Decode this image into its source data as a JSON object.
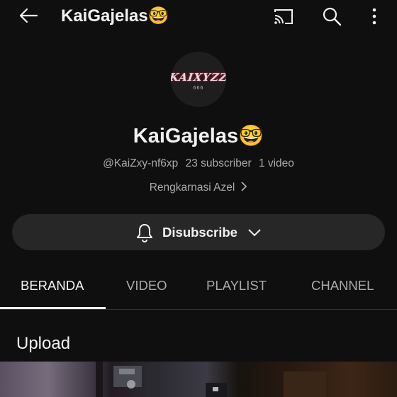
{
  "topbar": {
    "title": "KaiGajelas🤓",
    "icons": {
      "back": "back-arrow-icon",
      "cast": "cast-icon",
      "search": "search-icon",
      "more": "more-vert-icon"
    }
  },
  "channel": {
    "avatar_logo_text": "KAIXYZZ",
    "avatar_logo_subtext": "666",
    "name": "KaiGajelas🤓",
    "handle": "@KaiZxy-nf6xp",
    "subscribers": "23 subscriber",
    "videos": "1 video",
    "link_text": "Rengkarnasi Azel"
  },
  "subscribe_button": {
    "label": "Disubscribe",
    "icon": "bell-icon"
  },
  "tabs": [
    {
      "label": "BERANDA",
      "active": true
    },
    {
      "label": "VIDEO",
      "active": false
    },
    {
      "label": "PLAYLIST",
      "active": false
    },
    {
      "label": "CHANNEL",
      "active": false
    }
  ],
  "section": {
    "title": "Upload"
  },
  "colors": {
    "background": "#0f0f0f",
    "text": "#f1f1f1",
    "secondary_text": "#aaaaaa",
    "button_bg": "#272727"
  }
}
